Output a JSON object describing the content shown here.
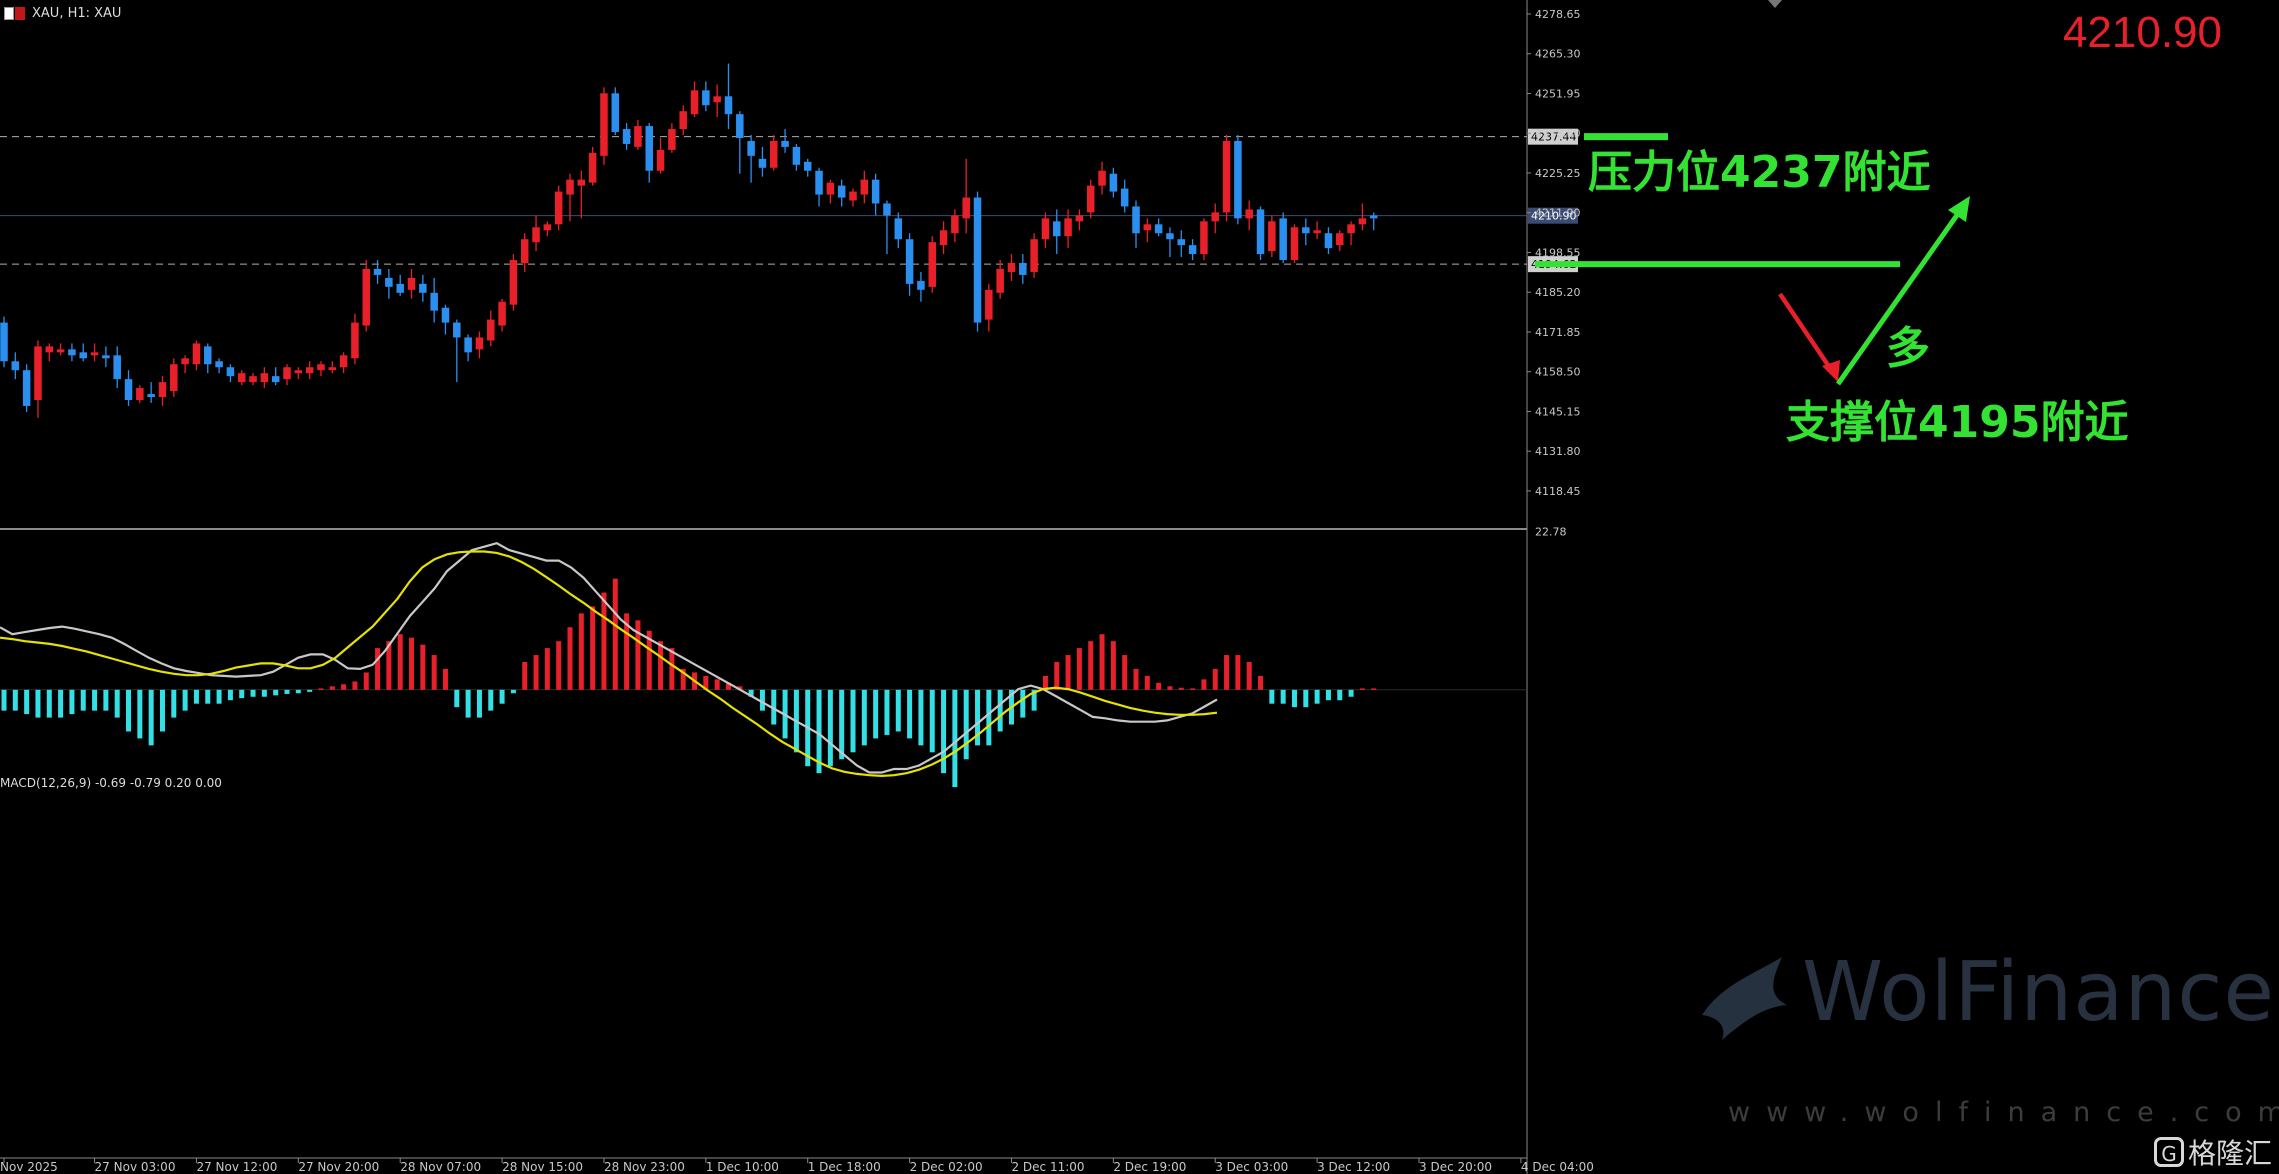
{
  "window": {
    "symbol_label": "XAU, H1:  XAU",
    "current_price": "4210.90"
  },
  "annotations": {
    "resistance": "压力位4237附近",
    "support": "支撑位4195附近",
    "direction": "多"
  },
  "macd_header": "MACD(12,26,9) -0.69 -0.79 0.20 0.00",
  "watermark": {
    "text": "WolFinance",
    "url": "www.wolfinance.com"
  },
  "brand": {
    "glyph": "G",
    "name": "格隆汇"
  },
  "colors": {
    "background": "#000000",
    "bull_candle": "#e8202a",
    "bear_candle": "#2b8fef",
    "macd_positive": "#e8202a",
    "macd_negative": "#33e0e6",
    "macd_signal_line": "#e6e200",
    "macd_main_line": "#c8c8c8",
    "annotation_green": "#33e233",
    "annotation_arrow_red": "#e8202a"
  },
  "chart_data": {
    "type": "candlestick",
    "price_axis": {
      "ylim": [
        4106,
        4282
      ],
      "ticks": [
        "4278.65",
        "4265.30",
        "4251.95",
        "4238.60",
        "4225.25",
        "4211.90",
        "4198.55",
        "4185.20",
        "4171.85",
        "4158.50",
        "4145.15",
        "4131.80",
        "4118.45"
      ]
    },
    "price_lines": [
      {
        "label": "4237.44",
        "value": 4237.44,
        "style": "dashed"
      },
      {
        "label": "4210.90",
        "value": 4210.9,
        "style": "solid"
      },
      {
        "label": "4194.62",
        "value": 4194.62,
        "style": "dashed"
      }
    ],
    "x_labels": [
      "Nov 2025",
      "27 Nov 03:00",
      "27 Nov 12:00",
      "27 Nov 20:00",
      "28 Nov 07:00",
      "28 Nov 15:00",
      "28 Nov 23:00",
      "1 Dec 10:00",
      "1 Dec 18:00",
      "2 Dec 02:00",
      "2 Dec 11:00",
      "2 Dec 19:00",
      "3 Dec 03:00",
      "3 Dec 12:00",
      "3 Dec 20:00",
      "4 Dec 04:00"
    ],
    "x_label_bar_index": [
      0,
      8,
      17,
      26,
      35,
      44,
      53,
      62,
      71,
      80,
      89,
      98,
      107,
      116,
      125,
      134
    ],
    "candles": [
      [
        4175,
        4177,
        4160,
        4162
      ],
      [
        4162,
        4165,
        4156,
        4159
      ],
      [
        4159,
        4161,
        4145,
        4147
      ],
      [
        4149,
        4169,
        4143,
        4167
      ],
      [
        4165,
        4168,
        4162,
        4167
      ],
      [
        4165,
        4168,
        4164,
        4166
      ],
      [
        4166,
        4168,
        4162,
        4164
      ],
      [
        4165,
        4168,
        4162,
        4163
      ],
      [
        4164,
        4168,
        4162,
        4165
      ],
      [
        4164,
        4167,
        4160,
        4163
      ],
      [
        4164,
        4167,
        4153,
        4156
      ],
      [
        4156,
        4159,
        4147,
        4149
      ],
      [
        4149,
        4154,
        4148,
        4153
      ],
      [
        4151,
        4155,
        4148,
        4150
      ],
      [
        4150,
        4157,
        4147,
        4155
      ],
      [
        4152,
        4163,
        4150,
        4161
      ],
      [
        4161,
        4164,
        4158,
        4163
      ],
      [
        4161,
        4169,
        4159,
        4168
      ],
      [
        4167,
        4168,
        4158,
        4161
      ],
      [
        4162,
        4163,
        4158,
        4160
      ],
      [
        4160,
        4161,
        4155,
        4157
      ],
      [
        4155,
        4159,
        4154,
        4158
      ],
      [
        4155,
        4158,
        4154,
        4157
      ],
      [
        4155,
        4160,
        4153,
        4158
      ],
      [
        4157,
        4160,
        4154,
        4155
      ],
      [
        4156,
        4161,
        4154,
        4160
      ],
      [
        4158,
        4160,
        4156,
        4159
      ],
      [
        4158,
        4162,
        4156,
        4160
      ],
      [
        4159,
        4162,
        4157,
        4161
      ],
      [
        4159,
        4162,
        4158,
        4160
      ],
      [
        4160,
        4165,
        4158,
        4164
      ],
      [
        4163,
        4178,
        4161,
        4175
      ],
      [
        4174,
        4196,
        4172,
        4193
      ],
      [
        4193,
        4196,
        4188,
        4191
      ],
      [
        4190,
        4193,
        4183,
        4187
      ],
      [
        4188,
        4191,
        4184,
        4185
      ],
      [
        4186,
        4193,
        4183,
        4190
      ],
      [
        4188,
        4191,
        4182,
        4185
      ],
      [
        4185,
        4190,
        4175,
        4179
      ],
      [
        4180,
        4181,
        4171,
        4175
      ],
      [
        4175,
        4176,
        4155,
        4170
      ],
      [
        4170,
        4171,
        4162,
        4165
      ],
      [
        4166,
        4172,
        4163,
        4170
      ],
      [
        4169,
        4179,
        4167,
        4176
      ],
      [
        4174,
        4183,
        4172,
        4182
      ],
      [
        4181,
        4198,
        4179,
        4196
      ],
      [
        4195,
        4205,
        4192,
        4203
      ],
      [
        4202,
        4211,
        4199,
        4207
      ],
      [
        4206,
        4209,
        4204,
        4208
      ],
      [
        4208,
        4221,
        4206,
        4219
      ],
      [
        4218,
        4225,
        4209,
        4223
      ],
      [
        4221,
        4226,
        4210,
        4223
      ],
      [
        4222,
        4234,
        4221,
        4232
      ],
      [
        4231,
        4254,
        4228,
        4252
      ],
      [
        4252,
        4254,
        4238,
        4239
      ],
      [
        4240,
        4242,
        4233,
        4235
      ],
      [
        4234,
        4243,
        4233,
        4241
      ],
      [
        4241,
        4242,
        4222,
        4226
      ],
      [
        4226,
        4237,
        4225,
        4233
      ],
      [
        4233,
        4242,
        4232,
        4240
      ],
      [
        4240,
        4248,
        4238,
        4246
      ],
      [
        4245,
        4256,
        4244,
        4253
      ],
      [
        4253,
        4256,
        4246,
        4248
      ],
      [
        4249,
        4255,
        4244,
        4251
      ],
      [
        4251,
        4262,
        4240,
        4245
      ],
      [
        4245,
        4246,
        4225,
        4237
      ],
      [
        4236,
        4238,
        4222,
        4231
      ],
      [
        4230,
        4234,
        4224,
        4227
      ],
      [
        4227,
        4238,
        4226,
        4236
      ],
      [
        4236,
        4240,
        4232,
        4234
      ],
      [
        4234,
        4235,
        4226,
        4228
      ],
      [
        4229,
        4230,
        4224,
        4226
      ],
      [
        4226,
        4227,
        4214,
        4218
      ],
      [
        4218,
        4223,
        4215,
        4222
      ],
      [
        4221,
        4223,
        4214,
        4217
      ],
      [
        4216,
        4220,
        4214,
        4219
      ],
      [
        4218,
        4226,
        4215,
        4223
      ],
      [
        4223,
        4225,
        4211,
        4215
      ],
      [
        4215,
        4216,
        4198,
        4211
      ],
      [
        4210,
        4212,
        4200,
        4203
      ],
      [
        4203,
        4205,
        4184,
        4188
      ],
      [
        4189,
        4192,
        4182,
        4186
      ],
      [
        4187,
        4204,
        4185,
        4202
      ],
      [
        4201,
        4209,
        4198,
        4206
      ],
      [
        4205,
        4213,
        4202,
        4211
      ],
      [
        4210,
        4230,
        4205,
        4217
      ],
      [
        4217,
        4219,
        4172,
        4175
      ],
      [
        4176,
        4188,
        4172,
        4186
      ],
      [
        4185,
        4196,
        4183,
        4193
      ],
      [
        4192,
        4198,
        4189,
        4195
      ],
      [
        4195,
        4198,
        4188,
        4191
      ],
      [
        4192,
        4205,
        4190,
        4203
      ],
      [
        4203,
        4212,
        4200,
        4210
      ],
      [
        4209,
        4213,
        4198,
        4204
      ],
      [
        4204,
        4213,
        4200,
        4210
      ],
      [
        4209,
        4213,
        4206,
        4211
      ],
      [
        4212,
        4223,
        4210,
        4221
      ],
      [
        4221,
        4229,
        4218,
        4226
      ],
      [
        4225,
        4227,
        4217,
        4219
      ],
      [
        4220,
        4223,
        4212,
        4214
      ],
      [
        4214,
        4216,
        4200,
        4205
      ],
      [
        4206,
        4210,
        4202,
        4208
      ],
      [
        4208,
        4210,
        4204,
        4205
      ],
      [
        4205,
        4207,
        4197,
        4203
      ],
      [
        4203,
        4206,
        4197,
        4201
      ],
      [
        4201,
        4203,
        4196,
        4198
      ],
      [
        4198,
        4210,
        4196,
        4209
      ],
      [
        4209,
        4215,
        4205,
        4212
      ],
      [
        4212,
        4238,
        4209,
        4236
      ],
      [
        4236,
        4238,
        4208,
        4210
      ],
      [
        4210,
        4216,
        4206,
        4213
      ],
      [
        4213,
        4214,
        4196,
        4198
      ],
      [
        4199,
        4211,
        4197,
        4209
      ],
      [
        4210,
        4212,
        4195,
        4196
      ],
      [
        4196,
        4208,
        4195,
        4207
      ],
      [
        4207,
        4210,
        4201,
        4205
      ],
      [
        4205,
        4209,
        4203,
        4206
      ],
      [
        4205,
        4207,
        4198,
        4200
      ],
      [
        4201,
        4206,
        4199,
        4205
      ],
      [
        4205,
        4209,
        4201,
        4208
      ],
      [
        4208,
        4215,
        4206,
        4210
      ],
      [
        4211,
        4212,
        4206,
        4210
      ]
    ],
    "macd": {
      "label": "MACD(12,26,9) -0.69 -0.79 0.20 0.00",
      "ylim": [
        -15,
        23
      ],
      "top_tick": "22.78",
      "histogram": [
        -3,
        -3,
        -3.5,
        -4,
        -4,
        -4,
        -3.5,
        -3,
        -3,
        -3,
        -4,
        -6,
        -7,
        -8,
        -6,
        -4,
        -3,
        -2,
        -2,
        -2,
        -1.5,
        -1.2,
        -1,
        -1,
        -0.8,
        -0.6,
        -0.5,
        -0.3,
        0.2,
        0.5,
        0.8,
        1.2,
        2.5,
        6,
        7,
        8,
        7.5,
        6.5,
        5,
        3,
        -2.5,
        -4,
        -4,
        -3,
        -2,
        -0.5,
        4,
        5,
        6,
        7,
        9,
        11,
        12,
        14,
        16,
        11,
        10,
        8.5,
        7,
        6,
        3,
        2.5,
        2,
        1.5,
        1,
        0.5,
        -1,
        -3,
        -5,
        -7,
        -9,
        -11,
        -12,
        -11,
        -10,
        -9,
        -8,
        -7,
        -6.5,
        -6,
        -7,
        -8,
        -9,
        -12,
        -14,
        -10,
        -8,
        -8,
        -6,
        -5,
        -4,
        -3,
        2,
        4,
        5,
        6,
        7,
        8,
        7,
        5,
        3,
        2,
        1,
        0.5,
        0.3,
        0.2,
        1.5,
        3,
        5,
        5,
        4,
        2,
        -2,
        -2,
        -2.5,
        -2.5,
        -2,
        -1.5,
        -1.5,
        -1,
        0.2,
        0.2
      ],
      "main_line": [
        9,
        8,
        8.3,
        8.6,
        8.9,
        9.1,
        8.8,
        8.4,
        8.0,
        7.5,
        6.6,
        5.6,
        4.6,
        3.8,
        3.1,
        2.7,
        2.4,
        2.1,
        2.0,
        1.9,
        2.0,
        2.1,
        2.6,
        3.6,
        4.6,
        5.1,
        5.1,
        4.3,
        3.1,
        3.0,
        3.6,
        5.6,
        8.1,
        10.6,
        12.6,
        14.6,
        17.1,
        18.6,
        20.1,
        20.6,
        21.1,
        20.1,
        19.6,
        19.1,
        18.6,
        18.6,
        17.6,
        16.1,
        14.1,
        12.1,
        10.1,
        8.6,
        7.6,
        6.6,
        5.6,
        4.6,
        3.6,
        2.6,
        1.6,
        0.6,
        -0.4,
        -1.4,
        -2.4,
        -3.4,
        -4.4,
        -5.4,
        -6.4,
        -7.9,
        -9.4,
        -10.9,
        -11.9,
        -11.9,
        -11.4,
        -11.4,
        -10.9,
        -9.9,
        -8.9,
        -7.4,
        -5.9,
        -4.4,
        -2.9,
        -1.4,
        0.1,
        0.6,
        0.1,
        -0.9,
        -1.9,
        -2.9,
        -3.9,
        -4.1,
        -4.4,
        -4.6,
        -4.6,
        -4.6,
        -4.4,
        -3.9,
        -3.4,
        -2.4,
        -1.4
      ],
      "signal_line": [
        7.5,
        7.3,
        7.0,
        6.8,
        6.6,
        6.3,
        5.9,
        5.5,
        5.0,
        4.5,
        4.0,
        3.5,
        3.0,
        2.6,
        2.3,
        2.1,
        2.1,
        2.3,
        2.7,
        3.2,
        3.5,
        3.8,
        3.8,
        3.5,
        3.1,
        3.1,
        3.6,
        4.6,
        6.1,
        7.6,
        9.1,
        11.1,
        13.1,
        15.6,
        17.6,
        18.8,
        19.5,
        19.8,
        19.9,
        19.9,
        19.7,
        19.2,
        18.4,
        17.4,
        16.2,
        15.0,
        13.7,
        12.5,
        11.2,
        10.0,
        8.7,
        7.5,
        6.2,
        5.0,
        3.7,
        2.5,
        1.2,
        -0.1,
        -1.3,
        -2.6,
        -3.8,
        -5.0,
        -6.3,
        -7.5,
        -8.5,
        -9.5,
        -10.5,
        -11.3,
        -11.8,
        -12.1,
        -12.3,
        -12.4,
        -12.3,
        -12.0,
        -11.5,
        -10.8,
        -9.9,
        -8.8,
        -7.5,
        -6.1,
        -4.6,
        -3.1,
        -1.8,
        -0.6,
        0.1,
        0.3,
        0.1,
        -0.4,
        -1.0,
        -1.6,
        -2.1,
        -2.6,
        -3.0,
        -3.3,
        -3.5,
        -3.6,
        -3.6,
        -3.5,
        -3.3
      ]
    }
  }
}
